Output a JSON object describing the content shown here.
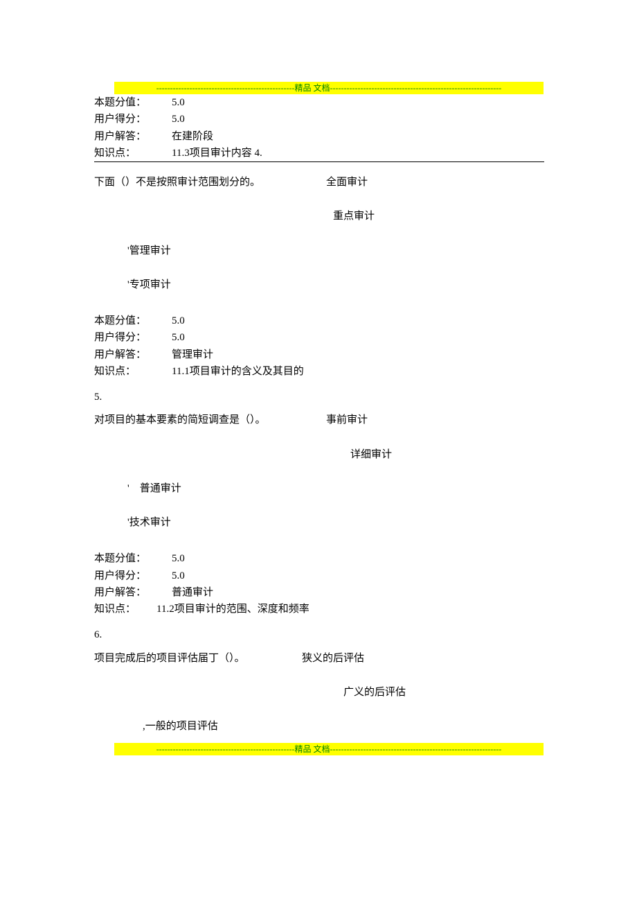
{
  "banner": {
    "left_dash": "--------------------------------------------------",
    "center": "精品 文档",
    "right_dash": "--------------------------------------------------------------"
  },
  "q3": {
    "score_label": "本题分值：",
    "score_val": "5.0",
    "user_score_label": "用户得分：",
    "user_score_val": "5.0",
    "user_answer_label": "用户解答：",
    "user_answer_val": "在建阶段",
    "kp_label": "知识点：",
    "kp_val": "11.3项目审计内容 4."
  },
  "q4": {
    "text": "下面（）不是按照审计范围划分的。",
    "opt_a": "全面审计",
    "opt_b": "重点审计",
    "opt_c": "'管理审计",
    "opt_d": "'专项审计",
    "score_label": "本题分值：",
    "score_val": "5.0",
    "user_score_label": "用户得分：",
    "user_score_val": "5.0",
    "user_answer_label": "用户解答：",
    "user_answer_val": "管理审计",
    "kp_label": "知识点：",
    "kp_val": "11.1项目审计的含义及其目的"
  },
  "num5": "5.",
  "q5": {
    "text": "对项目的基本要素的简短调查是（）。",
    "opt_a": "事前审计",
    "opt_b": "详细审计",
    "opt_c": "'　普通审计",
    "opt_d": "'技术审计",
    "score_label": "本题分值：",
    "score_val": "5.0",
    "user_score_label": "用户得分：",
    "user_score_val": "5.0",
    "user_answer_label": "用户解答：",
    "user_answer_val": "普通审计",
    "kp_label": "知识点：",
    "kp_val": "11.2项目审计的范围、深度和频率"
  },
  "num6": "6.",
  "q6": {
    "text": "项目完成后的项目评估届丁（）。",
    "opt_a": "狭义的后评估",
    "opt_b": "广义的后评估",
    "opt_c": ",一般的项目评估"
  }
}
